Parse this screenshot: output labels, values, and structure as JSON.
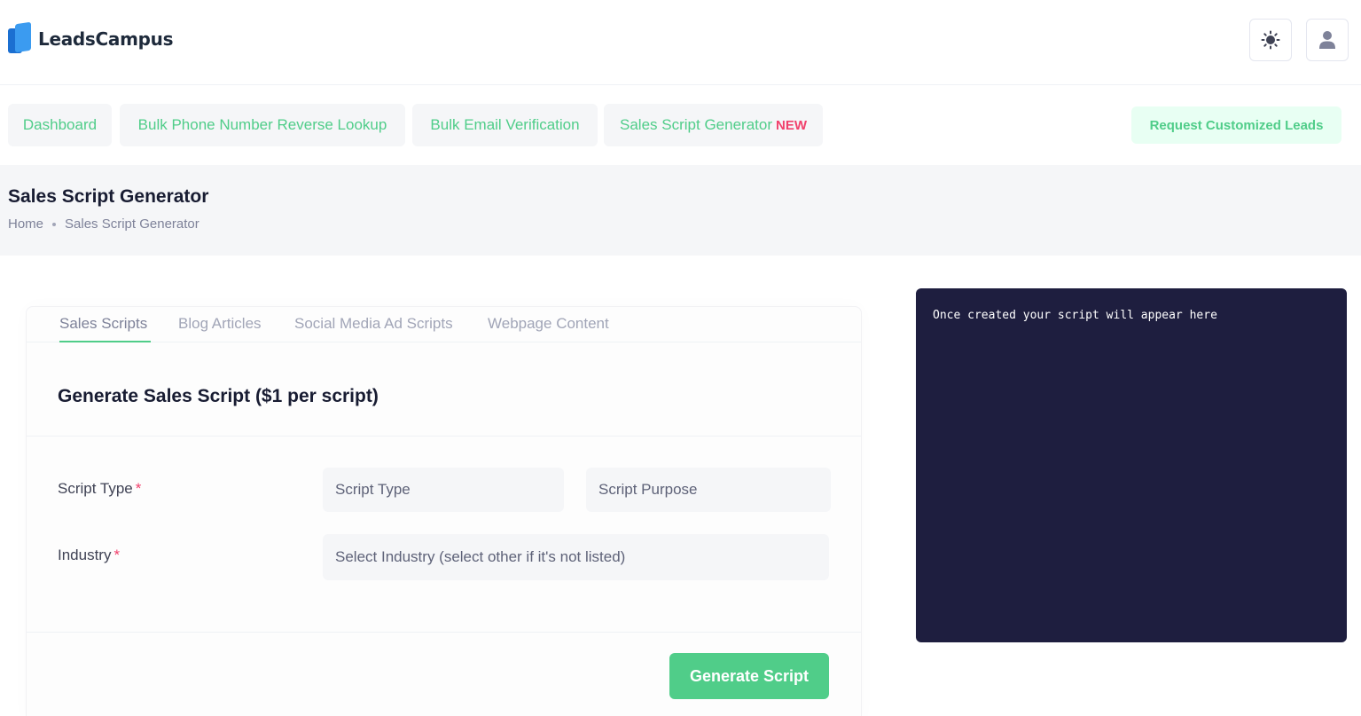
{
  "header": {
    "logo_text": "LeadsCampus",
    "theme_icon": "sun-icon",
    "user_icon": "user-icon"
  },
  "nav": {
    "items": [
      {
        "label": "Dashboard"
      },
      {
        "label": "Bulk Phone Number Reverse Lookup"
      },
      {
        "label": "Bulk Email Verification"
      },
      {
        "label": "Sales Script Generator",
        "badge": "NEW"
      }
    ],
    "request_button": "Request Customized Leads"
  },
  "toolbar": {
    "title": "Sales Script Generator",
    "breadcrumb": [
      "Home",
      "Sales Script Generator"
    ]
  },
  "card": {
    "tabs": [
      {
        "label": "Sales Scripts",
        "active": true
      },
      {
        "label": "Blog Articles",
        "active": false
      },
      {
        "label": "Social Media Ad Scripts",
        "active": false
      },
      {
        "label": "Webpage Content",
        "active": false
      }
    ],
    "title": "Generate Sales Script ($1 per script)",
    "form": {
      "script_type_label": "Script Type",
      "required_mark": "*",
      "script_type_placeholder": "Script Type",
      "script_purpose_placeholder": "Script Purpose",
      "industry_label": "Industry",
      "industry_placeholder": "Select Industry (select other if it's not listed)"
    },
    "submit_label": "Generate Script"
  },
  "output": {
    "placeholder_text": "Once created your script will appear here"
  },
  "colors": {
    "accent_green": "#50cd89",
    "light_green_bg": "#e8fff3",
    "danger": "#f1416c",
    "output_bg": "#1e1e3f",
    "toolbar_bg": "#f5f6f8"
  }
}
